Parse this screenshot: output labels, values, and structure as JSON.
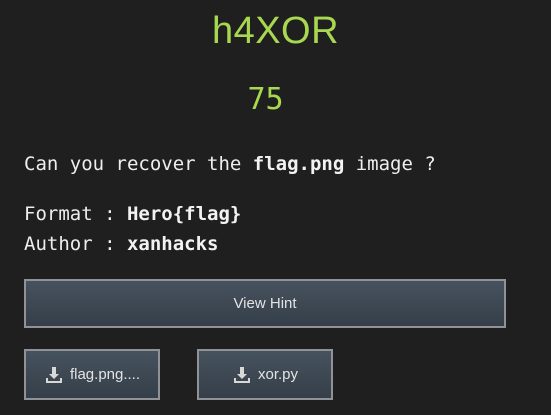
{
  "challenge": {
    "title": "h4XOR",
    "points": "75",
    "description_prefix": "Can you recover the ",
    "description_file": "flag.png",
    "description_suffix": " image ?",
    "format_label": "Format : ",
    "format_value": "Hero{flag}",
    "author_label": "Author : ",
    "author_value": "xanhacks"
  },
  "hint_button": {
    "label": "View Hint"
  },
  "files": [
    {
      "label": "flag.png....",
      "icon": "download-icon"
    },
    {
      "label": "xor.py",
      "icon": "download-icon"
    }
  ],
  "colors": {
    "background": "#1f1f1f",
    "accent": "#a8d84f",
    "button": "#3f4a55"
  }
}
